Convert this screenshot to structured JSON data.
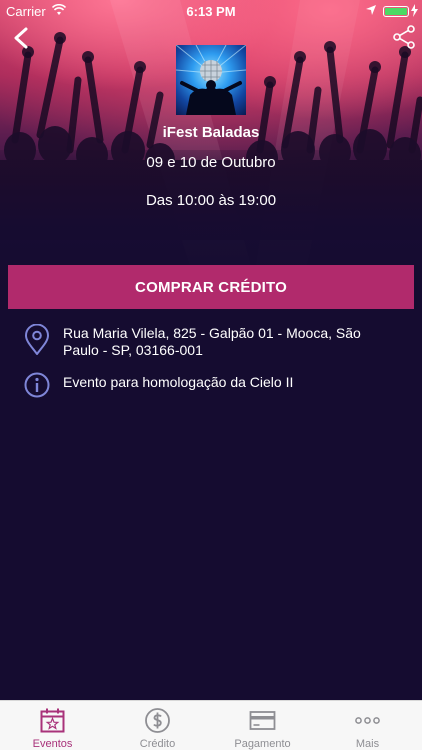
{
  "status_bar": {
    "carrier": "Carrier",
    "time": "6:13 PM"
  },
  "event": {
    "title": "iFest Baladas",
    "date": "09 e 10 de Outubro",
    "hours": "Das 10:00 às 19:00"
  },
  "buy_button_label": "COMPRAR CRÉDITO",
  "details": {
    "address": "Rua Maria Vilela, 825 - Galpão 01 - Mooca, São Paulo - SP, 03166-001",
    "description": "Evento para homologação da Cielo II"
  },
  "tabs": [
    {
      "label": "Eventos",
      "icon": "calendar-star-icon",
      "active": true
    },
    {
      "label": "Crédito",
      "icon": "dollar-circle-icon",
      "active": false
    },
    {
      "label": "Pagamento",
      "icon": "credit-card-icon",
      "active": false
    },
    {
      "label": "Mais",
      "icon": "more-dots-icon",
      "active": false
    }
  ],
  "colors": {
    "accent": "#b12a6c",
    "active_tab": "#a8327a",
    "background": "#150c30",
    "icon_tint": "#7f86d8"
  }
}
